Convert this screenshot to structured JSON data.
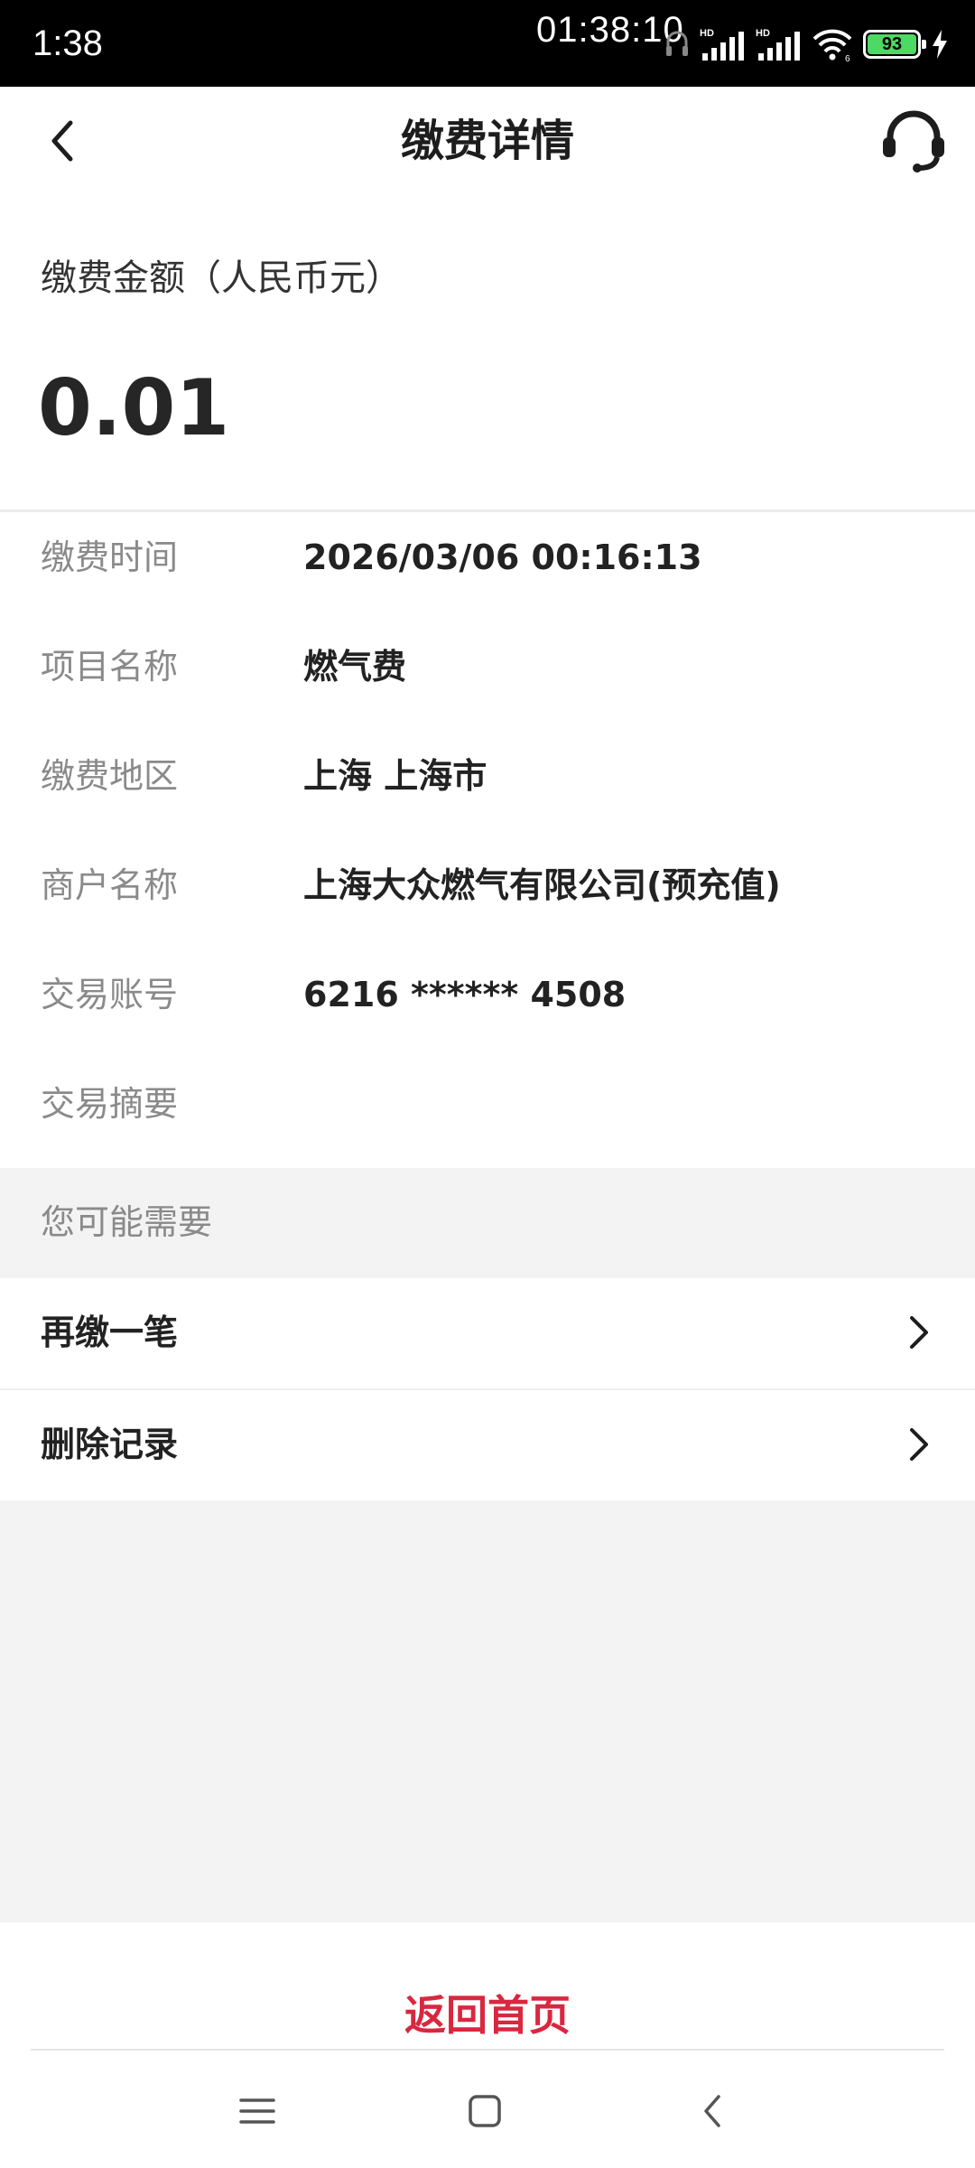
{
  "status_bar": {
    "time": "1:38",
    "clock": "01:38:10",
    "battery_level": "93",
    "icons": [
      "headset-indicator-icon",
      "hd-signal-icon",
      "hd-signal-icon",
      "wifi-icon",
      "battery-icon",
      "charging-icon"
    ]
  },
  "header": {
    "title": "缴费详情",
    "back_icon": "chevron-left-icon",
    "service_icon": "headset-icon"
  },
  "amount": {
    "label": "缴费金额（人民币元）",
    "value": "0.01"
  },
  "details": [
    {
      "label": "缴费时间",
      "value": "2026/03/06 00:16:13"
    },
    {
      "label": "项目名称",
      "value": "燃气费"
    },
    {
      "label": "缴费地区",
      "value": "上海 上海市"
    },
    {
      "label": "商户名称",
      "value": "上海大众燃气有限公司(预充值)"
    },
    {
      "label": "交易账号",
      "value": "6216 ****** 4508"
    },
    {
      "label": "交易摘要",
      "value": ""
    }
  ],
  "suggestions": {
    "heading": "您可能需要",
    "actions": [
      {
        "label": "再缴一笔",
        "icon": "chevron-right-icon"
      },
      {
        "label": "删除记录",
        "icon": "chevron-right-icon"
      }
    ]
  },
  "bottom": {
    "home_label": "返回首页"
  },
  "nav_bar": {
    "icons": [
      "menu-icon",
      "home-icon",
      "back-icon"
    ]
  },
  "colors": {
    "accent": "#d8283f",
    "page_bg": "#f3f3f3",
    "text_primary": "#222222",
    "text_secondary": "#8a8a8a"
  }
}
